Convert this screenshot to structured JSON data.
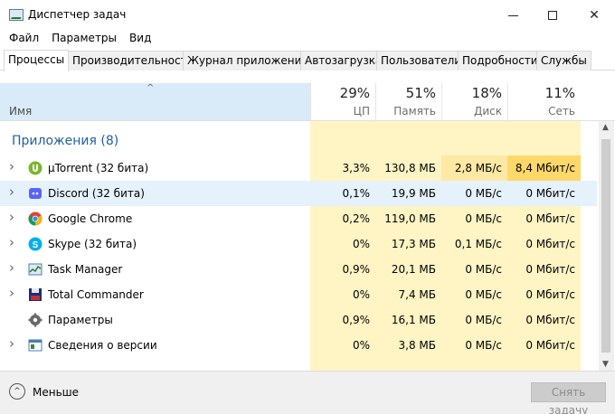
{
  "window": {
    "title": "Диспетчер задач"
  },
  "menu": [
    "Файл",
    "Параметры",
    "Вид"
  ],
  "tabs": [
    "Процессы",
    "Производительность",
    "Журнал приложений",
    "Автозагрузка",
    "Пользователи",
    "Подробности",
    "Службы"
  ],
  "columns": {
    "name": "Имя",
    "cpu": {
      "percent": "29%",
      "label": "ЦП"
    },
    "mem": {
      "percent": "51%",
      "label": "Память"
    },
    "disk": {
      "percent": "18%",
      "label": "Диск"
    },
    "net": {
      "percent": "11%",
      "label": "Сеть"
    }
  },
  "group": {
    "label": "Приложения (8)"
  },
  "rows": [
    {
      "name": "µTorrent (32 бита)",
      "icon": "utorrent-icon",
      "cpu": "3,3%",
      "mem": "130,8 МБ",
      "disk": "2,8 МБ/с",
      "net": "8,4 Мбит/с",
      "expandable": true
    },
    {
      "name": "Discord (32 бита)",
      "icon": "discord-icon",
      "cpu": "0,1%",
      "mem": "19,9 МБ",
      "disk": "0 МБ/с",
      "net": "0 Мбит/с",
      "expandable": true
    },
    {
      "name": "Google Chrome",
      "icon": "chrome-icon",
      "cpu": "0,2%",
      "mem": "119,0 МБ",
      "disk": "0 МБ/с",
      "net": "0 Мбит/с",
      "expandable": true
    },
    {
      "name": "Skype (32 бита)",
      "icon": "skype-icon",
      "cpu": "0%",
      "mem": "17,3 МБ",
      "disk": "0,1 МБ/с",
      "net": "0 Мбит/с",
      "expandable": true
    },
    {
      "name": "Task Manager",
      "icon": "task-manager-icon",
      "cpu": "0,9%",
      "mem": "20,1 МБ",
      "disk": "0 МБ/с",
      "net": "0 Мбит/с",
      "expandable": true
    },
    {
      "name": "Total Commander",
      "icon": "total-commander-icon",
      "cpu": "0%",
      "mem": "7,4 МБ",
      "disk": "0 МБ/с",
      "net": "0 Мбит/с",
      "expandable": true
    },
    {
      "name": "Параметры",
      "icon": "settings-gear-icon",
      "cpu": "0,9%",
      "mem": "16,1 МБ",
      "disk": "0 МБ/с",
      "net": "0 Мбит/с",
      "expandable": false
    },
    {
      "name": "Сведения о версии",
      "icon": "version-info-icon",
      "cpu": "0%",
      "mem": "3,8 МБ",
      "disk": "0 МБ/с",
      "net": "0 Мбит/с",
      "expandable": true
    }
  ],
  "footer": {
    "less_label": "Меньше",
    "end_task_label": "Снять задачу"
  },
  "colors": {
    "cpu_col": "#fff4c4",
    "mem_col": "#fff4c4",
    "disk_col": "#fff4c4",
    "net_col": "#fff4c4",
    "heat_light": "#fff4c4",
    "heat_mid": "#ffe8a3",
    "heat_strong": "#ffd86a",
    "selected_row": "#e5f1fb",
    "group_label": "#1f5fa8"
  }
}
